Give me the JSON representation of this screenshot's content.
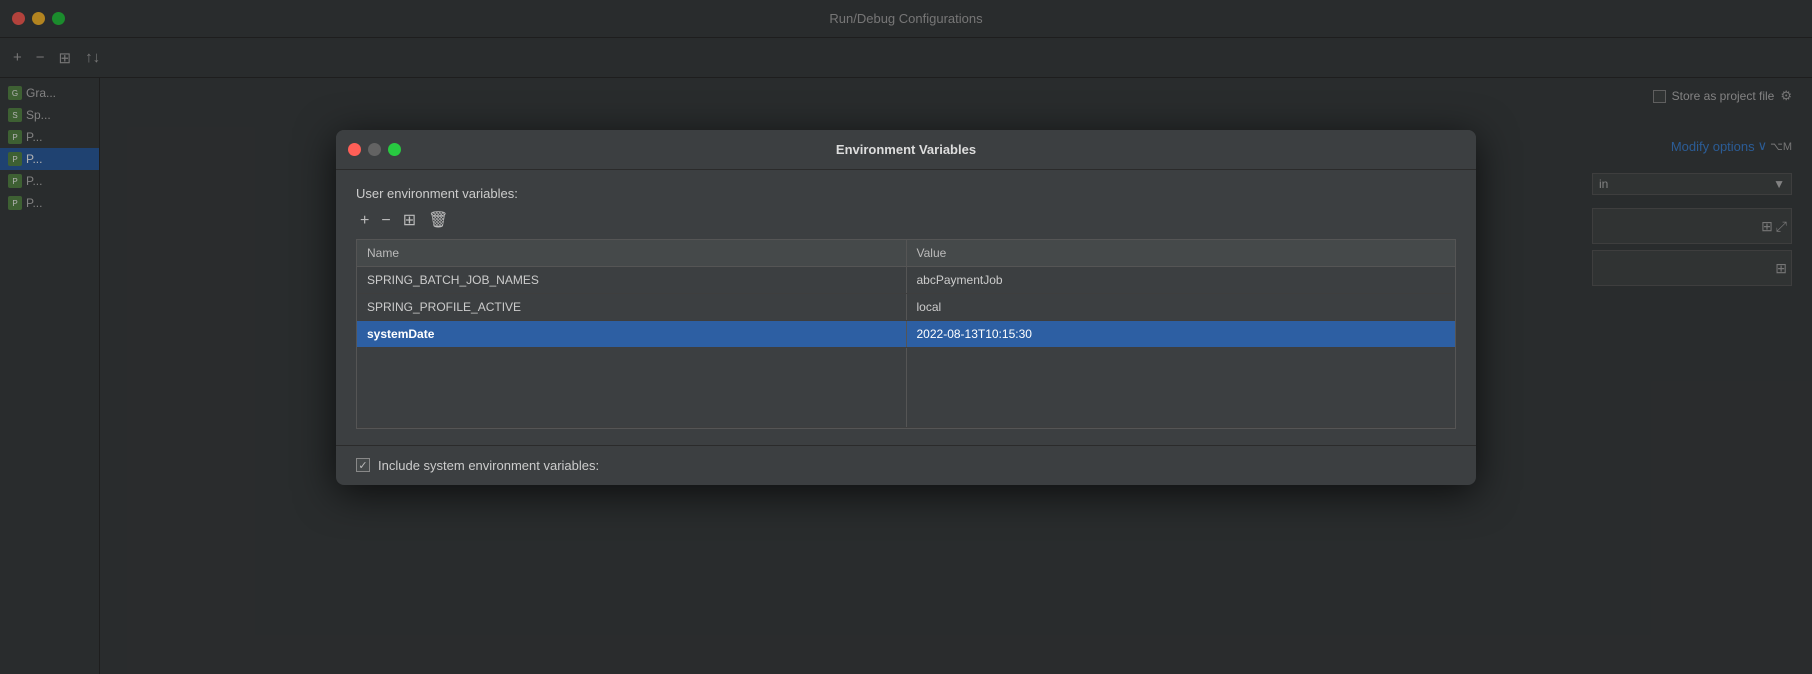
{
  "window": {
    "title": "Run/Debug Configurations"
  },
  "titlebar": {
    "dots": [
      "red",
      "yellow",
      "green"
    ]
  },
  "sidebar": {
    "items": [
      {
        "label": "Gra...",
        "icon": "G",
        "active": false
      },
      {
        "label": "Sp...",
        "icon": "S",
        "active": false
      },
      {
        "label": "P...",
        "icon": "P",
        "active": false
      },
      {
        "label": "P...",
        "icon": "P",
        "active": true
      },
      {
        "label": "P...",
        "icon": "P",
        "active": false
      },
      {
        "label": "P...",
        "icon": "P",
        "active": false
      }
    ]
  },
  "right_panel": {
    "store_as_project_label": "Store as project file",
    "modify_options_label": "Modify options",
    "modify_options_shortcut": "⌥M",
    "dropdown_value": "in"
  },
  "dialog": {
    "title": "Environment Variables",
    "section_label": "User environment variables:",
    "toolbar": {
      "add_label": "+",
      "remove_label": "−",
      "copy_label": "⊞",
      "delete_label": "🗑"
    },
    "table": {
      "columns": [
        "Name",
        "Value"
      ],
      "rows": [
        {
          "name": "SPRING_BATCH_JOB_NAMES",
          "value": "abcPaymentJob",
          "selected": false
        },
        {
          "name": "SPRING_PROFILE_ACTIVE",
          "value": "local",
          "selected": false
        },
        {
          "name": "systemDate",
          "value": "2022-08-13T10:15:30",
          "selected": true
        }
      ]
    },
    "footer": {
      "include_system_env_label": "Include system environment variables:",
      "checkbox_checked": true
    }
  }
}
